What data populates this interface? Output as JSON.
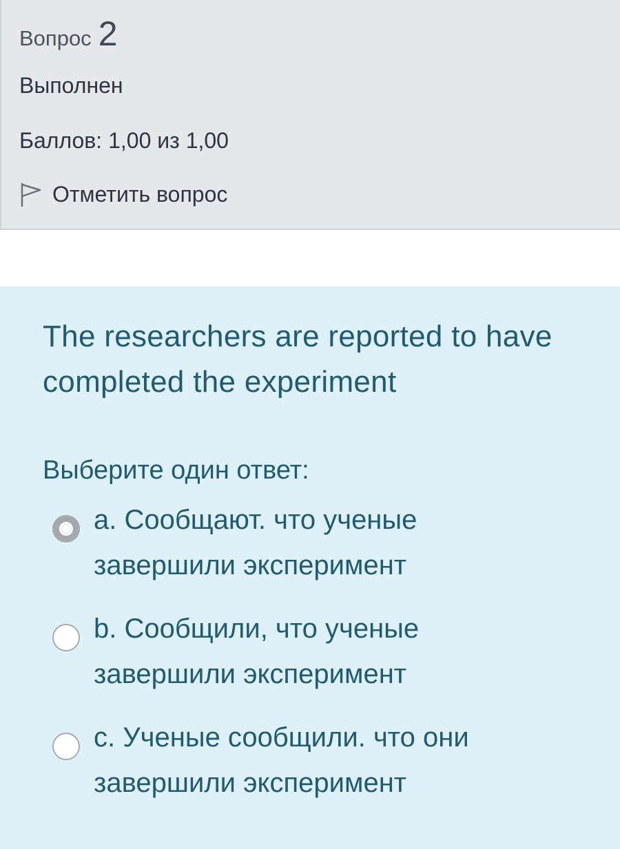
{
  "info": {
    "title_prefix": "Вопрос",
    "number": "2",
    "state": "Выполнен",
    "grade": "Баллов: 1,00 из 1,00",
    "flag_label": "Отметить вопрос",
    "flag_icon": "flag-outline-icon"
  },
  "question": {
    "text": "The researchers are reported to have completed the experiment",
    "prompt": "Выберите один ответ:",
    "options": [
      {
        "label": "a. Сообщают. что ученые завершили эксперимент",
        "selected": true
      },
      {
        "label": "b. Сообщили, что ученые завершили эксперимент",
        "selected": false
      },
      {
        "label": "c. Ученые сообщили. что они завершили эксперимент",
        "selected": false
      }
    ]
  },
  "colors": {
    "info_bg": "#e5e7eb",
    "content_bg": "#def0f8",
    "question_text": "#215b70",
    "info_text": "#2d353d"
  }
}
